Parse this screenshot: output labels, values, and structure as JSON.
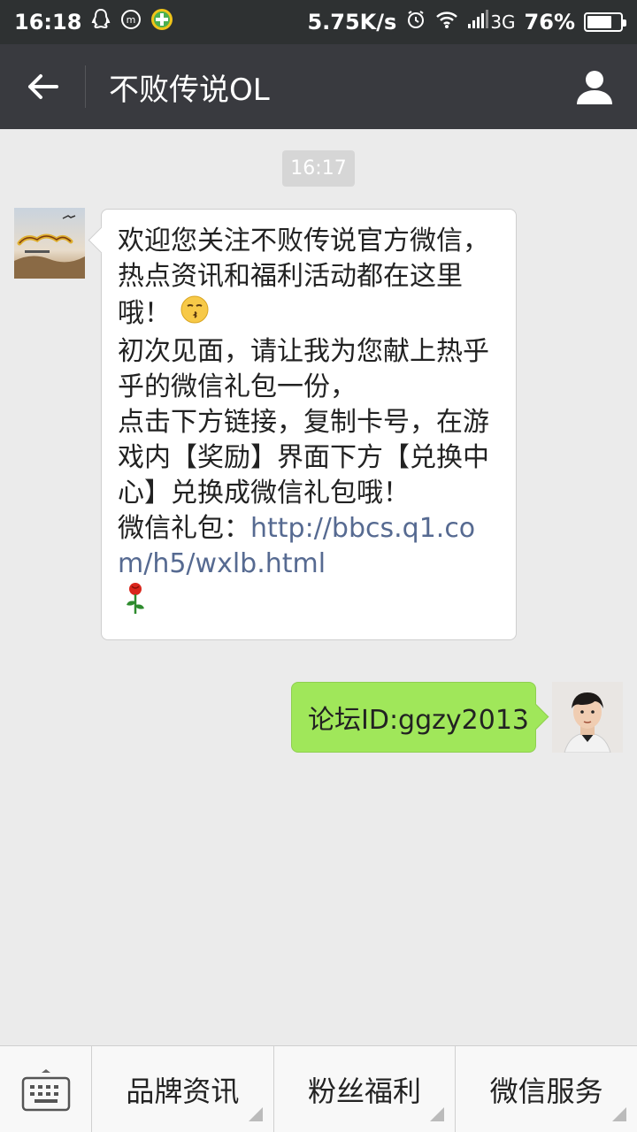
{
  "status_bar": {
    "time": "16:18",
    "network_speed": "5.75K/s",
    "network_type": "3G",
    "battery_percent": "76%",
    "battery_level": 0.76
  },
  "header": {
    "title": "不败传说OL"
  },
  "chat": {
    "timestamp": "16:17",
    "incoming": {
      "line1": "欢迎您关注不败传说官方微信，热点资讯和福利活动都在这里哦！",
      "line2": "初次见面，请让我为您献上热乎乎的微信礼包一份，",
      "line3": "点击下方链接，复制卡号，在游戏内【奖励】界面下方【兑换中心】兑换成微信礼包哦！",
      "link_prefix": "微信礼包：",
      "link": "http://bbcs.q1.com/h5/wxlb.html"
    },
    "outgoing": {
      "text": "论坛ID:ggzy2013"
    }
  },
  "bottom_menu": {
    "items": [
      {
        "label": "品牌资讯"
      },
      {
        "label": "粉丝福利"
      },
      {
        "label": "微信服务"
      }
    ]
  },
  "colors": {
    "status_bg": "#2e3132",
    "header_bg": "#393a3f",
    "chat_bg": "#ebebeb",
    "outgoing_bubble": "#a0e75a",
    "link": "#566a91"
  }
}
